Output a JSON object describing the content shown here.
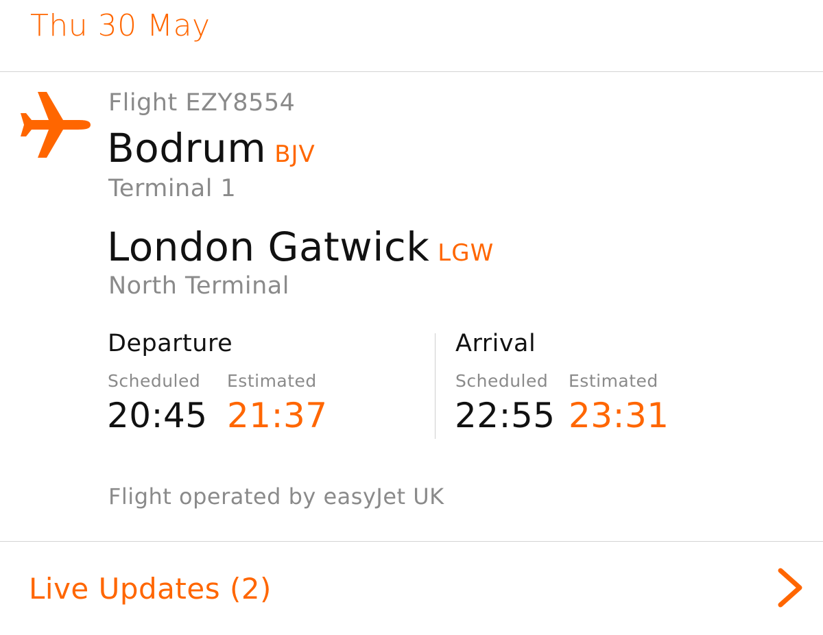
{
  "header": {
    "date": "Thu 30 May"
  },
  "flight": {
    "icon": "plane-icon",
    "number_label": "Flight EZY8554",
    "origin": {
      "city": "Bodrum",
      "code": "BJV",
      "terminal": "Terminal 1"
    },
    "destination": {
      "city": "London Gatwick",
      "code": "LGW",
      "terminal": "North Terminal"
    },
    "departure": {
      "title": "Departure",
      "scheduled_label": "Scheduled",
      "estimated_label": "Estimated",
      "scheduled": "20:45",
      "estimated": "21:37"
    },
    "arrival": {
      "title": "Arrival",
      "scheduled_label": "Scheduled",
      "estimated_label": "Estimated",
      "scheduled": "22:55",
      "estimated": "23:31"
    },
    "operator": "Flight operated by easyJet UK"
  },
  "live_updates": {
    "label": "Live Updates (2)",
    "icon": "chevron-right-icon"
  },
  "colors": {
    "accent": "#ff6600",
    "text": "#111111",
    "muted": "#8a8a8a",
    "divider": "#d4d4d4"
  }
}
